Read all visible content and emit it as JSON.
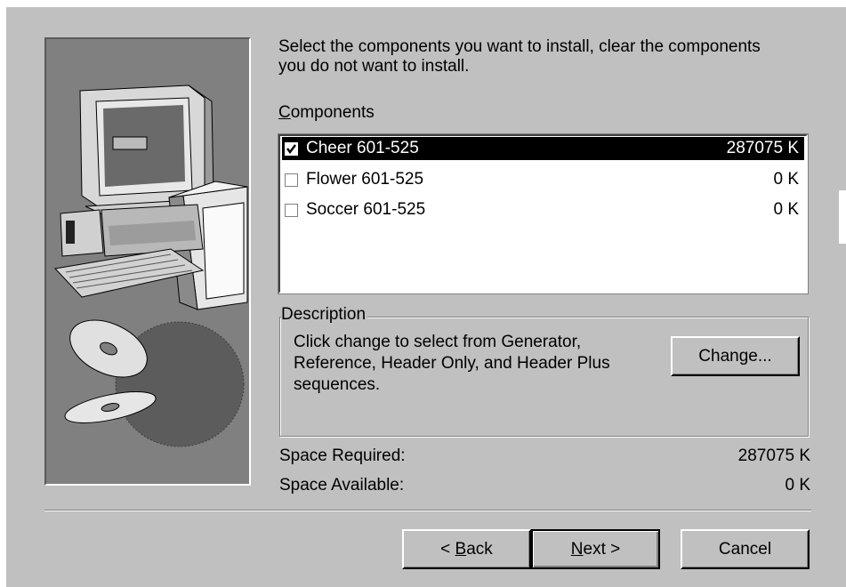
{
  "instructions": {
    "line1": "Select the components you want to install, clear the components",
    "line2": "you do not want to install."
  },
  "components": {
    "label_accel": "C",
    "label_rest": "omponents",
    "items": [
      {
        "name": "Cheer 601-525",
        "size": "287075 K",
        "checked": true,
        "selected": true
      },
      {
        "name": "Flower 601-525",
        "size": "0 K",
        "checked": false,
        "selected": false
      },
      {
        "name": "Soccer  601-525",
        "size": "0 K",
        "checked": false,
        "selected": false
      }
    ]
  },
  "description": {
    "title": "Description",
    "text": "Click change to select from Generator,\nReference, Header Only, and Header Plus\nsequences.",
    "change_button": "Change..."
  },
  "space": {
    "required_label": "Space Required:",
    "required_value": "287075 K",
    "available_label": "Space Available:",
    "available_value": "0 K"
  },
  "buttons": {
    "back_prefix": "< ",
    "back_accel": "B",
    "back_rest": "ack",
    "next_accel": "N",
    "next_rest": "ext >",
    "cancel": "Cancel"
  }
}
